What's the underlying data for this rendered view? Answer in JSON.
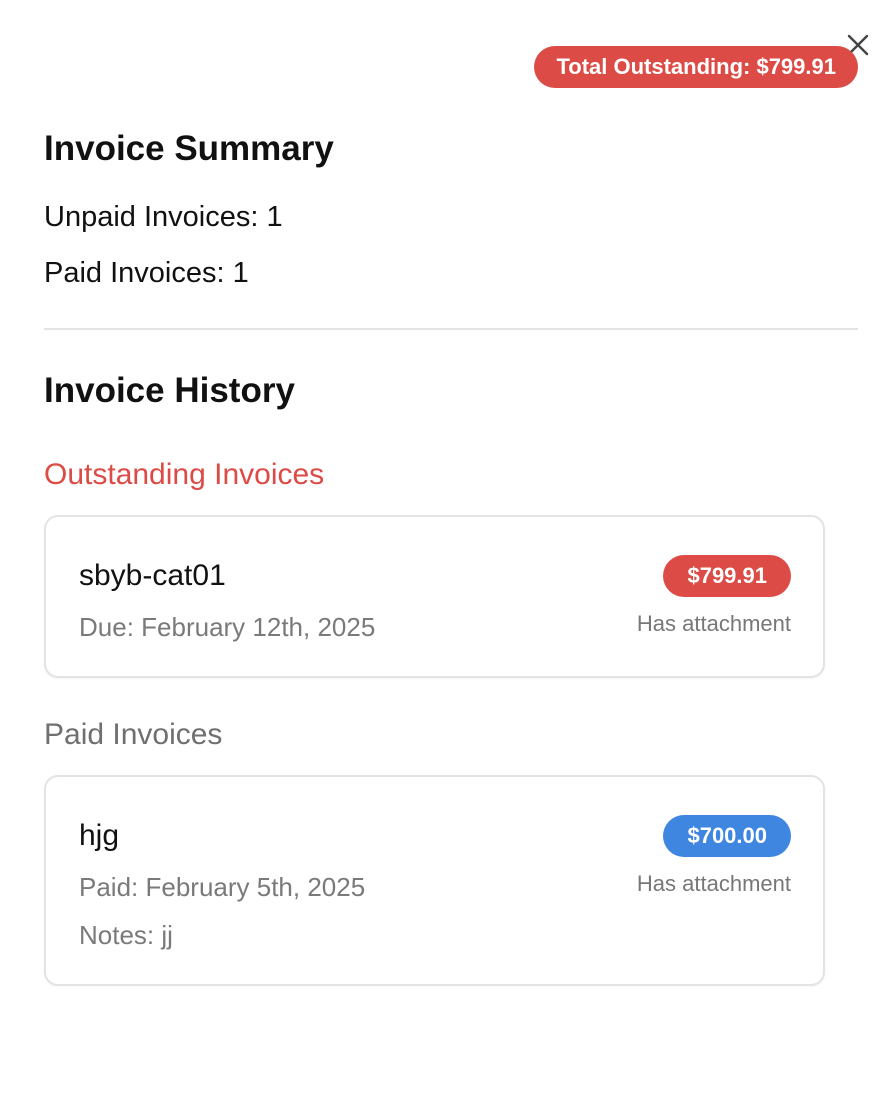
{
  "header": {
    "total_badge": "Total Outstanding: $799.91",
    "close_icon": "close-icon"
  },
  "summary": {
    "title": "Invoice Summary",
    "unpaid_line": "Unpaid Invoices: 1",
    "paid_line": "Paid Invoices: 1"
  },
  "history": {
    "title": "Invoice History",
    "outstanding": {
      "heading": "Outstanding Invoices",
      "items": [
        {
          "name": "sbyb-cat01",
          "date_line": "Due: February 12th, 2025",
          "amount": "$799.91",
          "attachment": "Has attachment"
        }
      ]
    },
    "paid": {
      "heading": "Paid Invoices",
      "items": [
        {
          "name": "hjg",
          "date_line": "Paid: February 5th, 2025",
          "notes": "Notes: jj",
          "amount": "$700.00",
          "attachment": "Has attachment"
        }
      ]
    }
  },
  "colors": {
    "danger": "#dc4b45",
    "paid_badge": "#3f86e0",
    "muted_text": "#7a7a7a",
    "border": "#e3e3e3"
  }
}
